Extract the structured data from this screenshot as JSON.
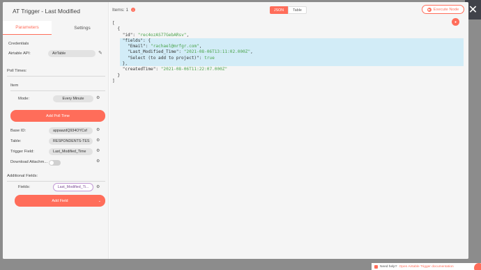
{
  "modal": {
    "title": "AT Trigger - Last Modified",
    "tabs": [
      "Parameters",
      "Settings"
    ]
  },
  "params": {
    "credentials_label": "Credentials",
    "airtable_api_label": "Airtable API:",
    "airtable_api_value": "AirTable",
    "poll_times_label": "Poll Times:",
    "item_label": "Item",
    "mode_label": "Mode:",
    "mode_value": "Every Minute",
    "add_poll_time": "Add Poll Time",
    "base_id_label": "Base ID:",
    "base_id_value": "appaazdQ934OYCsf",
    "table_label": "Table:",
    "table_value": "RESPONDENTS-TES",
    "trigger_field_label": "Trigger Field:",
    "trigger_field_value": "Last_Modified_Time",
    "download_attachments_label": "Download Attachm...",
    "additional_fields_label": "Additional Fields:",
    "fields_label": "Fields:",
    "fields_value": "Last_Modified_Ti...",
    "add_field": "Add Field"
  },
  "output": {
    "items_label": "Items: 1",
    "view_json": "JSON",
    "view_table": "Table",
    "execute_node": "Execute Node",
    "json": {
      "id_key": "\"id\"",
      "id_value": "\"rec4ozAS77GebARsv\"",
      "fields_key": "\"fields\"",
      "email_key": "\"Email\"",
      "email_value": "\"rachael@mrfgr.com\"",
      "lmt_key": "\"Last_Modified_Time\"",
      "lmt_value": "\"2021-08-06T13:11:02.000Z\"",
      "select_key": "\"Select (to add to project)\"",
      "select_value": "true",
      "created_key": "\"createdTime\"",
      "created_value": "\"2021-08-06T11:22:07.000Z\""
    }
  },
  "footer": {
    "need_help": "Need help?",
    "docs_link": "Open Airtable Trigger documentation"
  },
  "icons": {
    "close": "close-icon",
    "pencil": "pencil-icon",
    "gear": "gear-icon",
    "info": "info-icon",
    "execute": "play-icon",
    "chevron": "chevron-down-icon"
  },
  "colors": {
    "accent": "#ff6d5a",
    "highlight": "#d2ecf7",
    "string": "#4aa34a"
  }
}
